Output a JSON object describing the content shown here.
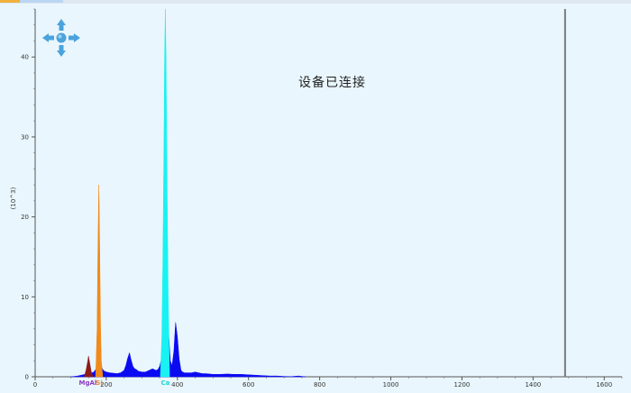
{
  "window": {
    "tabs": [
      "",
      ""
    ]
  },
  "status": {
    "connection_text": "设备已连接"
  },
  "colors": {
    "background": "#e9f6fd",
    "spectrum_fill": "#0b0bf2",
    "peak_mg": "#8b1a1a",
    "peak_si": "#f08a1a",
    "peak_ca": "#19f2f2",
    "marker_line": "#7a7a7a",
    "nav_icon": "#4aa3dd"
  },
  "icons": {
    "nav_up": "arrow-up-icon",
    "nav_down": "arrow-down-icon",
    "nav_left": "arrow-left-icon",
    "nav_right": "arrow-right-icon",
    "nav_center": "center-dot-icon"
  },
  "chart_data": {
    "type": "area",
    "title": "",
    "xlabel": "",
    "ylabel": "(10^3)",
    "xlim": [
      0,
      1650
    ],
    "ylim": [
      0,
      46
    ],
    "x_ticks": [
      "0",
      "200",
      "400",
      "600",
      "800",
      "1000",
      "1200",
      "1400",
      "1600"
    ],
    "x_tick_values": [
      0,
      200,
      400,
      600,
      800,
      1000,
      1200,
      1400,
      1600
    ],
    "y_ticks": [
      "0",
      "10",
      "20",
      "30",
      "40"
    ],
    "y_tick_values": [
      0,
      10,
      20,
      30,
      40
    ],
    "grid": false,
    "marker_x": 1490,
    "series": [
      {
        "x": [
          100,
          110,
          120,
          130,
          140,
          150,
          160,
          165,
          170,
          175,
          180,
          185,
          190,
          195,
          200,
          210,
          220,
          230,
          240,
          250,
          255,
          260,
          265,
          270,
          275,
          280,
          285,
          290,
          300,
          310,
          320,
          330,
          340,
          345,
          350,
          355,
          360,
          365,
          370,
          375,
          380,
          385,
          390,
          395,
          400,
          405,
          410,
          415,
          420,
          430,
          440,
          450,
          460,
          470,
          480,
          500,
          520,
          540,
          560,
          580,
          600,
          620,
          640,
          660,
          680,
          700,
          720,
          740,
          760
        ],
        "values": [
          0,
          0.05,
          0.1,
          0.2,
          0.3,
          0.4,
          0.5,
          0.6,
          0.9,
          1.6,
          2.4,
          1.4,
          0.9,
          0.7,
          0.6,
          0.5,
          0.45,
          0.4,
          0.5,
          0.8,
          1.4,
          2.3,
          3.0,
          2.1,
          1.3,
          1.0,
          0.9,
          0.7,
          0.6,
          0.6,
          0.8,
          1.0,
          0.8,
          0.9,
          1.3,
          2.2,
          3.4,
          5.0,
          8.6,
          5.5,
          2.0,
          1.4,
          3.2,
          6.8,
          5.0,
          2.2,
          0.8,
          0.6,
          0.5,
          0.5,
          0.5,
          0.6,
          0.5,
          0.4,
          0.4,
          0.3,
          0.3,
          0.35,
          0.3,
          0.3,
          0.25,
          0.2,
          0.15,
          0.1,
          0.1,
          0.05,
          0.02,
          0.1,
          0
        ]
      },
      {
        "label": "MgAl",
        "x": [
          138,
          143,
          148,
          150,
          153,
          158,
          163
        ],
        "values": [
          0,
          0.8,
          2.0,
          2.6,
          1.8,
          0.6,
          0
        ]
      },
      {
        "label": "Si",
        "x": [
          170,
          174,
          176,
          178,
          179,
          180,
          182,
          184,
          186,
          190
        ],
        "values": [
          0,
          6,
          14,
          21,
          24,
          22,
          14,
          6,
          2,
          0
        ]
      },
      {
        "label": "Ca",
        "x": [
          352,
          356,
          359,
          362,
          364,
          366,
          368,
          370,
          374,
          378
        ],
        "values": [
          0,
          5,
          14,
          28,
          40,
          46,
          40,
          28,
          10,
          0
        ]
      }
    ],
    "annotations": [
      {
        "text": "MgAl",
        "x": 148,
        "color": "#8a3dbf"
      },
      {
        "text": "Si",
        "x": 180,
        "color": "#f08a1a"
      },
      {
        "text": "Ca",
        "x": 366,
        "color": "#19d6d6"
      }
    ]
  }
}
